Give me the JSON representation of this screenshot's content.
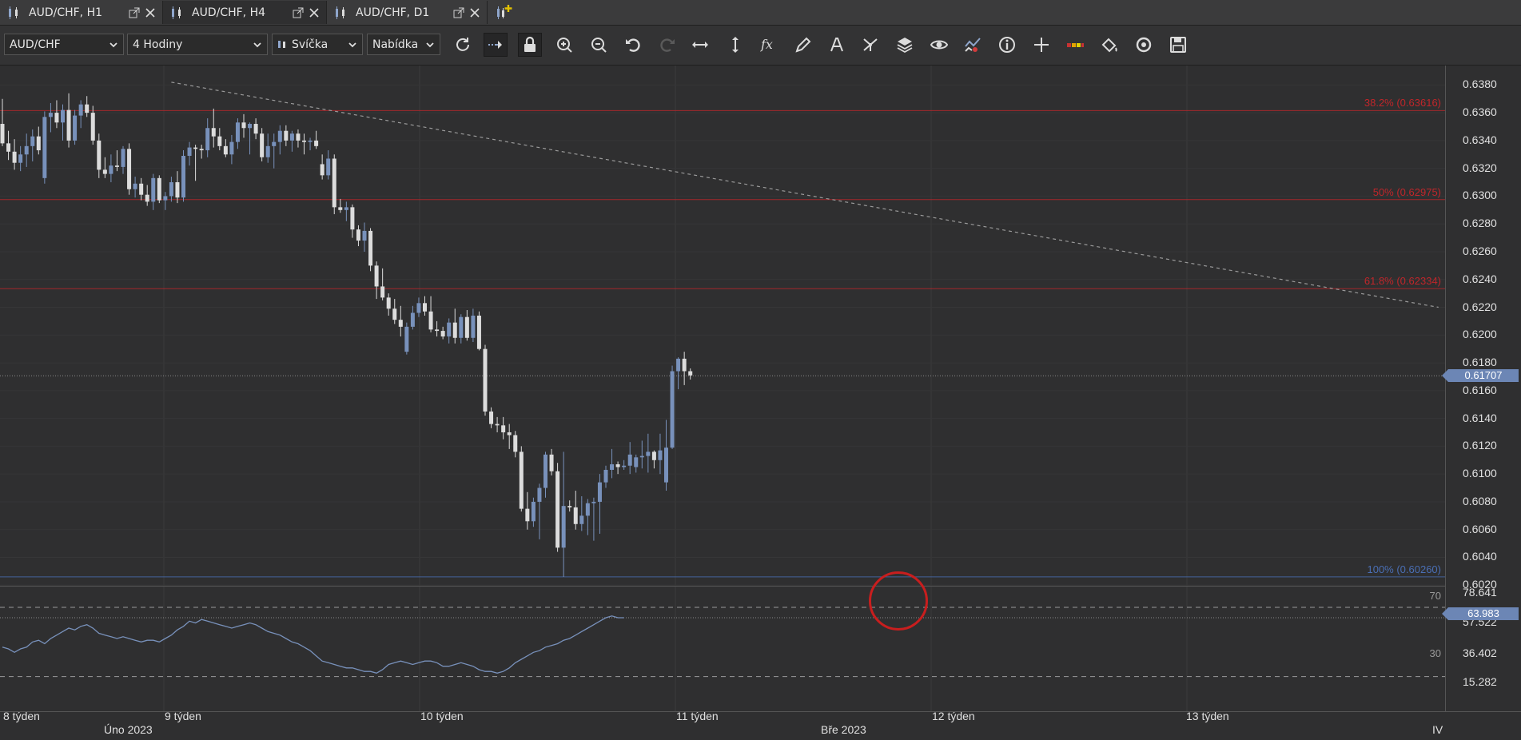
{
  "tabs": [
    {
      "label": "AUD/CHF, H1",
      "active": false
    },
    {
      "label": "AUD/CHF, H4",
      "active": true
    },
    {
      "label": "AUD/CHF, D1",
      "active": false
    }
  ],
  "toolbar": {
    "symbol": "AUD/CHF",
    "timeframe": "4 Hodiny",
    "chart_type": "Svíčka",
    "price_type": "Nabídka",
    "tools": [
      "refresh-icon",
      "autoscroll-icon",
      "lock-icon",
      "zoom-in-icon",
      "zoom-out-icon",
      "undo-icon",
      "redo-icon",
      "horizontal-scale-icon",
      "vertical-scale-icon",
      "indicator-fx-icon",
      "pencil-icon",
      "text-icon",
      "patterns-icon",
      "layers-icon",
      "eye-icon",
      "signals-icon",
      "info-icon",
      "crosshair-icon",
      "color-scheme-icon",
      "paint-bucket-icon",
      "sync-icon",
      "save-icon"
    ]
  },
  "price_axis": {
    "labels": [
      "0.6380",
      "0.6360",
      "0.6340",
      "0.6320",
      "0.6300",
      "0.6280",
      "0.6260",
      "0.6240",
      "0.6220",
      "0.6200",
      "0.6180",
      "0.6160",
      "0.6140",
      "0.6120",
      "0.6100",
      "0.6080",
      "0.6060",
      "0.6040",
      "0.6020"
    ],
    "current_price": "0.61707"
  },
  "fibonacci": [
    {
      "label": "38.2% (0.63616)",
      "price": 0.63616,
      "color": "#c0262a"
    },
    {
      "label": "50% (0.62975)",
      "price": 0.62975,
      "color": "#c0262a"
    },
    {
      "label": "61.8% (0.62334)",
      "price": 0.62334,
      "color": "#c0262a"
    },
    {
      "label": "100% (0.60260)",
      "price": 0.6026,
      "color": "#4a6fb5"
    }
  ],
  "rsi": {
    "axis_labels": [
      "78.641",
      "57.522",
      "36.402",
      "15.282"
    ],
    "current": "63.983",
    "level_high": "70",
    "level_low": "30"
  },
  "time_axis": {
    "weeks": [
      "8 týden",
      "9 týden",
      "10 týden",
      "11 týden",
      "12 týden",
      "13 týden"
    ],
    "months": [
      "Úno 2023",
      "Bře 2023",
      "IV"
    ]
  },
  "colors": {
    "bull": "#dcdcdc",
    "bear": "#7891bb",
    "trendline": "#9a9a9a",
    "rsi_line": "#7891bb"
  },
  "chart_data": {
    "type": "candlestick",
    "symbol": "AUD/CHF",
    "timeframe": "H4",
    "ylim": [
      0.6019,
      0.6394
    ],
    "candles": [
      {
        "o": 0.6352,
        "h": 0.637,
        "l": 0.6336,
        "c": 0.6338
      },
      {
        "o": 0.6338,
        "h": 0.6347,
        "l": 0.6326,
        "c": 0.6332
      },
      {
        "o": 0.6332,
        "h": 0.6341,
        "l": 0.6319,
        "c": 0.6324
      },
      {
        "o": 0.6324,
        "h": 0.6336,
        "l": 0.6318,
        "c": 0.633
      },
      {
        "o": 0.633,
        "h": 0.6345,
        "l": 0.6321,
        "c": 0.6336
      },
      {
        "o": 0.6336,
        "h": 0.6348,
        "l": 0.6325,
        "c": 0.6343
      },
      {
        "o": 0.6343,
        "h": 0.635,
        "l": 0.633,
        "c": 0.6333
      },
      {
        "o": 0.6313,
        "h": 0.6361,
        "l": 0.6309,
        "c": 0.6357
      },
      {
        "o": 0.6357,
        "h": 0.6367,
        "l": 0.6346,
        "c": 0.636
      },
      {
        "o": 0.636,
        "h": 0.6369,
        "l": 0.6349,
        "c": 0.6353
      },
      {
        "o": 0.6353,
        "h": 0.6366,
        "l": 0.634,
        "c": 0.6362
      },
      {
        "o": 0.6362,
        "h": 0.6374,
        "l": 0.6335,
        "c": 0.634
      },
      {
        "o": 0.634,
        "h": 0.6362,
        "l": 0.6337,
        "c": 0.6358
      },
      {
        "o": 0.6358,
        "h": 0.6369,
        "l": 0.6349,
        "c": 0.6366
      },
      {
        "o": 0.6366,
        "h": 0.6372,
        "l": 0.6357,
        "c": 0.636
      },
      {
        "o": 0.636,
        "h": 0.6365,
        "l": 0.6337,
        "c": 0.634
      },
      {
        "o": 0.634,
        "h": 0.6345,
        "l": 0.6313,
        "c": 0.6319
      },
      {
        "o": 0.6319,
        "h": 0.6328,
        "l": 0.6313,
        "c": 0.6316
      },
      {
        "o": 0.6316,
        "h": 0.633,
        "l": 0.631,
        "c": 0.6322
      },
      {
        "o": 0.6322,
        "h": 0.6333,
        "l": 0.6318,
        "c": 0.6321
      },
      {
        "o": 0.6321,
        "h": 0.6336,
        "l": 0.6316,
        "c": 0.6334
      },
      {
        "o": 0.6334,
        "h": 0.6338,
        "l": 0.6301,
        "c": 0.6305
      },
      {
        "o": 0.6305,
        "h": 0.6314,
        "l": 0.6299,
        "c": 0.6309
      },
      {
        "o": 0.6309,
        "h": 0.6313,
        "l": 0.6297,
        "c": 0.6301
      },
      {
        "o": 0.6301,
        "h": 0.6308,
        "l": 0.6293,
        "c": 0.6296
      },
      {
        "o": 0.6296,
        "h": 0.6316,
        "l": 0.629,
        "c": 0.6313
      },
      {
        "o": 0.6313,
        "h": 0.6315,
        "l": 0.6295,
        "c": 0.6297
      },
      {
        "o": 0.6297,
        "h": 0.6303,
        "l": 0.629,
        "c": 0.63
      },
      {
        "o": 0.63,
        "h": 0.6314,
        "l": 0.6296,
        "c": 0.631
      },
      {
        "o": 0.631,
        "h": 0.6318,
        "l": 0.6295,
        "c": 0.6299
      },
      {
        "o": 0.6299,
        "h": 0.6333,
        "l": 0.6296,
        "c": 0.6329
      },
      {
        "o": 0.6329,
        "h": 0.6339,
        "l": 0.6322,
        "c": 0.6335
      },
      {
        "o": 0.6335,
        "h": 0.6337,
        "l": 0.6311,
        "c": 0.6334
      },
      {
        "o": 0.6334,
        "h": 0.6337,
        "l": 0.6327,
        "c": 0.6333
      },
      {
        "o": 0.6333,
        "h": 0.6356,
        "l": 0.6328,
        "c": 0.6349
      },
      {
        "o": 0.6349,
        "h": 0.6363,
        "l": 0.6335,
        "c": 0.6343
      },
      {
        "o": 0.6343,
        "h": 0.6349,
        "l": 0.6333,
        "c": 0.6336
      },
      {
        "o": 0.6336,
        "h": 0.6341,
        "l": 0.6328,
        "c": 0.633
      },
      {
        "o": 0.633,
        "h": 0.6344,
        "l": 0.6323,
        "c": 0.6339
      },
      {
        "o": 0.6339,
        "h": 0.6356,
        "l": 0.6334,
        "c": 0.6353
      },
      {
        "o": 0.6353,
        "h": 0.6359,
        "l": 0.6342,
        "c": 0.6349
      },
      {
        "o": 0.6349,
        "h": 0.6353,
        "l": 0.633,
        "c": 0.6352
      },
      {
        "o": 0.6352,
        "h": 0.6356,
        "l": 0.6341,
        "c": 0.6345
      },
      {
        "o": 0.6345,
        "h": 0.6349,
        "l": 0.6325,
        "c": 0.6328
      },
      {
        "o": 0.6328,
        "h": 0.6345,
        "l": 0.6324,
        "c": 0.6336
      },
      {
        "o": 0.6336,
        "h": 0.6345,
        "l": 0.632,
        "c": 0.6339
      },
      {
        "o": 0.6339,
        "h": 0.6351,
        "l": 0.633,
        "c": 0.6347
      },
      {
        "o": 0.6347,
        "h": 0.6351,
        "l": 0.6336,
        "c": 0.634
      },
      {
        "o": 0.634,
        "h": 0.6347,
        "l": 0.6332,
        "c": 0.6345
      },
      {
        "o": 0.6345,
        "h": 0.6348,
        "l": 0.6335,
        "c": 0.634
      },
      {
        "o": 0.634,
        "h": 0.6345,
        "l": 0.633,
        "c": 0.6339
      },
      {
        "o": 0.6339,
        "h": 0.6342,
        "l": 0.6333,
        "c": 0.634
      },
      {
        "o": 0.634,
        "h": 0.6347,
        "l": 0.6334,
        "c": 0.6336
      },
      {
        "o": 0.6323,
        "h": 0.633,
        "l": 0.6312,
        "c": 0.6315
      },
      {
        "o": 0.6315,
        "h": 0.6333,
        "l": 0.6312,
        "c": 0.6327
      },
      {
        "o": 0.6327,
        "h": 0.633,
        "l": 0.6287,
        "c": 0.6292
      },
      {
        "o": 0.6292,
        "h": 0.6298,
        "l": 0.6288,
        "c": 0.629
      },
      {
        "o": 0.629,
        "h": 0.6296,
        "l": 0.6282,
        "c": 0.6292
      },
      {
        "o": 0.6292,
        "h": 0.6294,
        "l": 0.627,
        "c": 0.6276
      },
      {
        "o": 0.6276,
        "h": 0.6279,
        "l": 0.6264,
        "c": 0.6268
      },
      {
        "o": 0.6268,
        "h": 0.6281,
        "l": 0.626,
        "c": 0.6275
      },
      {
        "o": 0.6275,
        "h": 0.6277,
        "l": 0.6246,
        "c": 0.625
      },
      {
        "o": 0.625,
        "h": 0.6253,
        "l": 0.6226,
        "c": 0.6235
      },
      {
        "o": 0.6235,
        "h": 0.6248,
        "l": 0.6225,
        "c": 0.6227
      },
      {
        "o": 0.6227,
        "h": 0.623,
        "l": 0.6214,
        "c": 0.6219
      },
      {
        "o": 0.6219,
        "h": 0.6226,
        "l": 0.6208,
        "c": 0.6211
      },
      {
        "o": 0.6211,
        "h": 0.6221,
        "l": 0.6199,
        "c": 0.6206
      },
      {
        "o": 0.6188,
        "h": 0.6209,
        "l": 0.6186,
        "c": 0.6206
      },
      {
        "o": 0.6206,
        "h": 0.6221,
        "l": 0.6204,
        "c": 0.6216
      },
      {
        "o": 0.6216,
        "h": 0.6227,
        "l": 0.6213,
        "c": 0.6223
      },
      {
        "o": 0.6223,
        "h": 0.6228,
        "l": 0.6214,
        "c": 0.6217
      },
      {
        "o": 0.6217,
        "h": 0.6228,
        "l": 0.6202,
        "c": 0.6204
      },
      {
        "o": 0.6204,
        "h": 0.621,
        "l": 0.6199,
        "c": 0.6203
      },
      {
        "o": 0.6203,
        "h": 0.6206,
        "l": 0.6197,
        "c": 0.6199
      },
      {
        "o": 0.6199,
        "h": 0.6212,
        "l": 0.6194,
        "c": 0.6209
      },
      {
        "o": 0.6209,
        "h": 0.6219,
        "l": 0.6194,
        "c": 0.6198
      },
      {
        "o": 0.6198,
        "h": 0.6215,
        "l": 0.6194,
        "c": 0.6213
      },
      {
        "o": 0.6213,
        "h": 0.6218,
        "l": 0.6196,
        "c": 0.6198
      },
      {
        "o": 0.6198,
        "h": 0.6219,
        "l": 0.6195,
        "c": 0.6214
      },
      {
        "o": 0.6214,
        "h": 0.6217,
        "l": 0.6189,
        "c": 0.619
      },
      {
        "o": 0.619,
        "h": 0.6193,
        "l": 0.6142,
        "c": 0.6145
      },
      {
        "o": 0.6145,
        "h": 0.6148,
        "l": 0.6133,
        "c": 0.6136
      },
      {
        "o": 0.6136,
        "h": 0.6141,
        "l": 0.613,
        "c": 0.6135
      },
      {
        "o": 0.6135,
        "h": 0.6141,
        "l": 0.6125,
        "c": 0.613
      },
      {
        "o": 0.613,
        "h": 0.6136,
        "l": 0.6118,
        "c": 0.6128
      },
      {
        "o": 0.6128,
        "h": 0.6131,
        "l": 0.6112,
        "c": 0.6116
      },
      {
        "o": 0.6116,
        "h": 0.612,
        "l": 0.6073,
        "c": 0.6075
      },
      {
        "o": 0.6075,
        "h": 0.6087,
        "l": 0.606,
        "c": 0.6066
      },
      {
        "o": 0.6066,
        "h": 0.6083,
        "l": 0.6062,
        "c": 0.608
      },
      {
        "o": 0.608,
        "h": 0.6093,
        "l": 0.6053,
        "c": 0.609
      },
      {
        "o": 0.609,
        "h": 0.6116,
        "l": 0.6083,
        "c": 0.6114
      },
      {
        "o": 0.6114,
        "h": 0.6118,
        "l": 0.6099,
        "c": 0.6102
      },
      {
        "o": 0.6102,
        "h": 0.6108,
        "l": 0.6044,
        "c": 0.6047
      },
      {
        "o": 0.6047,
        "h": 0.6116,
        "l": 0.6026,
        "c": 0.6077
      },
      {
        "o": 0.6077,
        "h": 0.6081,
        "l": 0.6073,
        "c": 0.6076
      },
      {
        "o": 0.6076,
        "h": 0.6088,
        "l": 0.606,
        "c": 0.6064
      },
      {
        "o": 0.6064,
        "h": 0.6084,
        "l": 0.6059,
        "c": 0.607
      },
      {
        "o": 0.607,
        "h": 0.6082,
        "l": 0.6056,
        "c": 0.6079
      },
      {
        "o": 0.6079,
        "h": 0.6083,
        "l": 0.6052,
        "c": 0.608
      },
      {
        "o": 0.608,
        "h": 0.61,
        "l": 0.6057,
        "c": 0.6094
      },
      {
        "o": 0.6094,
        "h": 0.6106,
        "l": 0.609,
        "c": 0.6103
      },
      {
        "o": 0.6103,
        "h": 0.6118,
        "l": 0.6097,
        "c": 0.6107
      },
      {
        "o": 0.6107,
        "h": 0.6109,
        "l": 0.61,
        "c": 0.6105
      },
      {
        "o": 0.6105,
        "h": 0.611,
        "l": 0.6103,
        "c": 0.6106
      },
      {
        "o": 0.6106,
        "h": 0.6123,
        "l": 0.61,
        "c": 0.6114
      },
      {
        "o": 0.6105,
        "h": 0.6114,
        "l": 0.6101,
        "c": 0.6112
      },
      {
        "o": 0.6112,
        "h": 0.6124,
        "l": 0.6104,
        "c": 0.6113
      },
      {
        "o": 0.6113,
        "h": 0.6129,
        "l": 0.6101,
        "c": 0.6116
      },
      {
        "o": 0.6116,
        "h": 0.6117,
        "l": 0.6104,
        "c": 0.611
      },
      {
        "o": 0.611,
        "h": 0.6129,
        "l": 0.61,
        "c": 0.6117
      },
      {
        "o": 0.6094,
        "h": 0.6139,
        "l": 0.6088,
        "c": 0.6119
      },
      {
        "o": 0.6119,
        "h": 0.6178,
        "l": 0.6118,
        "c": 0.6174
      },
      {
        "o": 0.6174,
        "h": 0.6184,
        "l": 0.6161,
        "c": 0.6183
      },
      {
        "o": 0.6183,
        "h": 0.6188,
        "l": 0.6164,
        "c": 0.6174
      },
      {
        "o": 0.6174,
        "h": 0.6176,
        "l": 0.6168,
        "c": 0.6171
      }
    ],
    "rsi": [
      47,
      46,
      44,
      46,
      47,
      50,
      51,
      49,
      52,
      54,
      56,
      58,
      57,
      59,
      60,
      58,
      55,
      54,
      53,
      52,
      53,
      52,
      51,
      50,
      51,
      51,
      50,
      52,
      54,
      57,
      59,
      62,
      61,
      63,
      62,
      61,
      60,
      59,
      58,
      59,
      60,
      61,
      60,
      58,
      56,
      55,
      54,
      52,
      50,
      49,
      47,
      45,
      42,
      39,
      38,
      37,
      36,
      35,
      35,
      34,
      33,
      33,
      32,
      34,
      37,
      38,
      39,
      38,
      37,
      38,
      39,
      39,
      38,
      36,
      36,
      37,
      38,
      37,
      36,
      34,
      33,
      33,
      32,
      33,
      35,
      38,
      40,
      42,
      44,
      45,
      47,
      48,
      49,
      51,
      52,
      54,
      56,
      58,
      60,
      62,
      64,
      65,
      64,
      63.98
    ],
    "rsi_ylim": [
      10,
      82
    ],
    "trendline": {
      "from_index": 28,
      "from_price": 0.6382,
      "to_index": 185,
      "to_price": 0.622
    },
    "trendline_dashed": true
  }
}
